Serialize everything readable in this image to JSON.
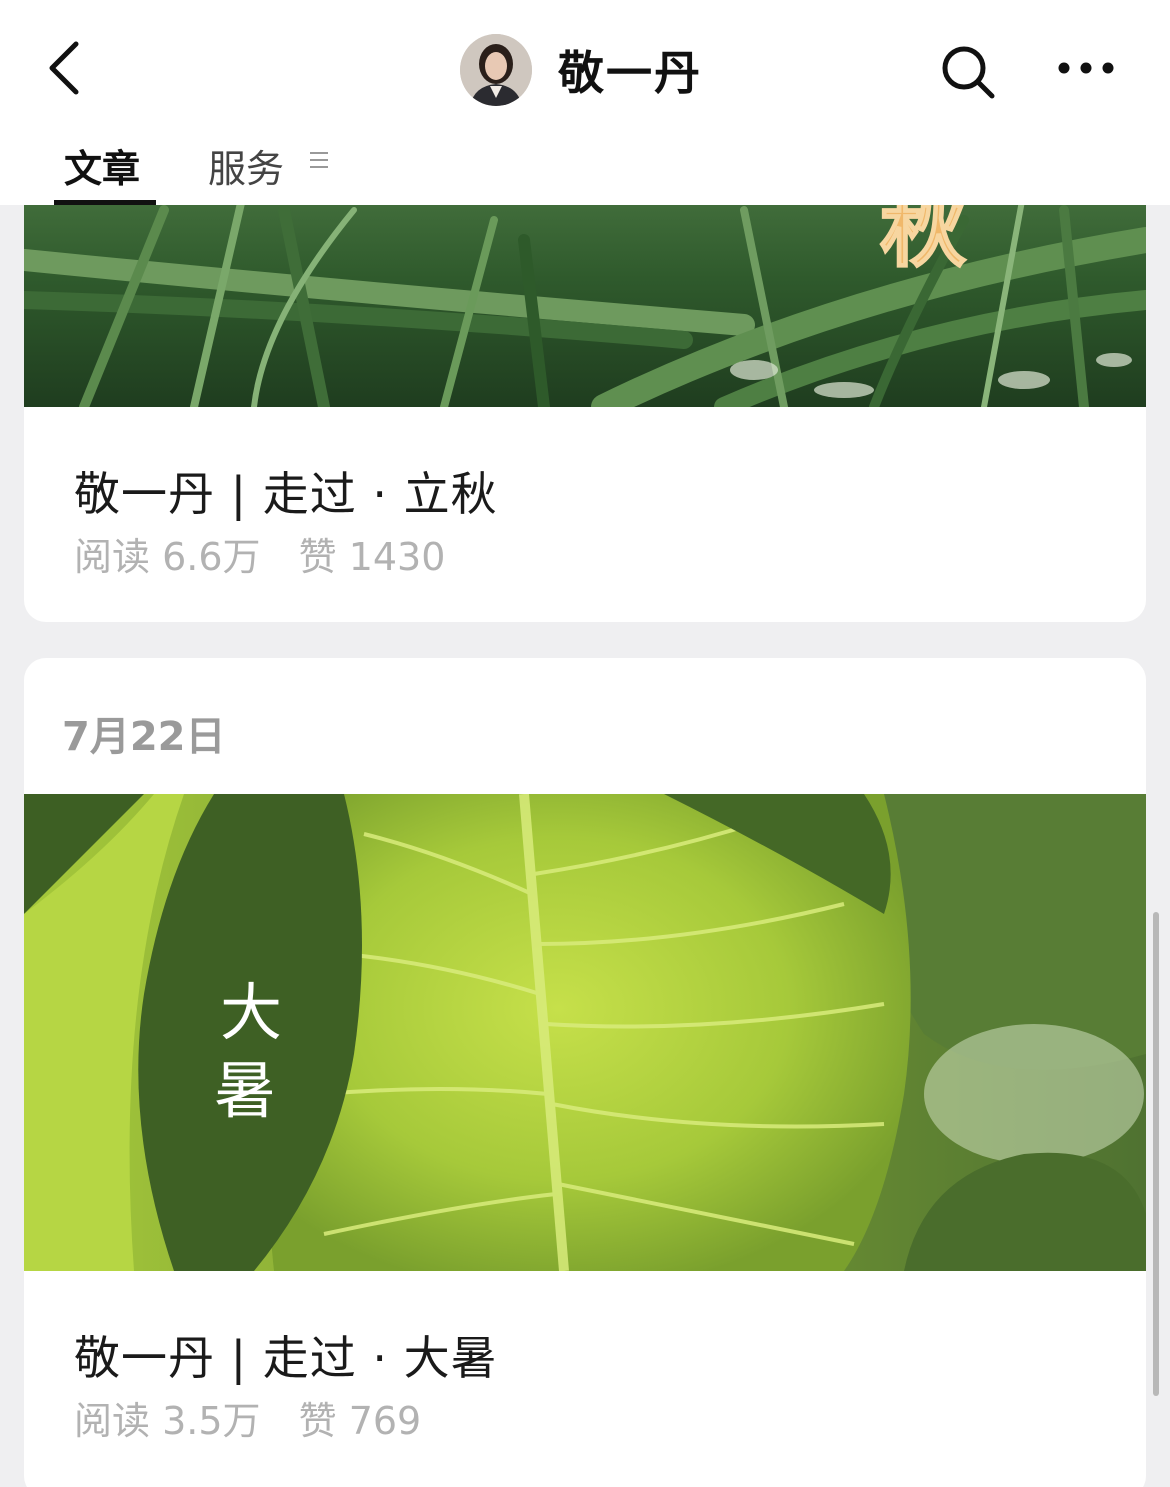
{
  "header": {
    "account_name": "敬一丹",
    "back_icon": "chevron-left-icon",
    "search_icon": "search-icon",
    "more_icon": "more-dots-icon"
  },
  "tabs": [
    {
      "label": "文章",
      "active": true
    },
    {
      "label": "服务",
      "active": false
    }
  ],
  "articles": [
    {
      "title": "敬一丹 | 走过 · 立秋",
      "reads": "阅读 6.6万",
      "likes": "赞 1430",
      "cover_text": "秋"
    },
    {
      "date": "7月22日",
      "title": "敬一丹 | 走过 · 大暑",
      "reads": "阅读 3.5万",
      "likes": "赞 769",
      "cover_text": [
        "大",
        "暑"
      ]
    }
  ],
  "colors": {
    "background": "#efeff1",
    "card": "#ffffff",
    "meta_text": "#b2b2b2",
    "date_text": "#9a9a9a"
  }
}
